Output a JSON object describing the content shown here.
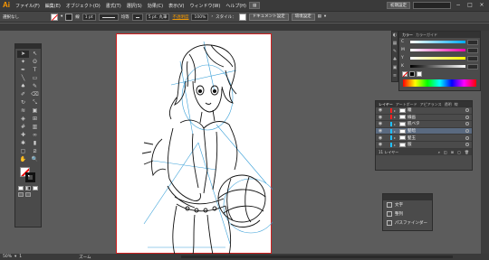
{
  "app": {
    "logo": "Ai"
  },
  "menu": [
    "ファイル(F)",
    "編集(E)",
    "オブジェクト(O)",
    "書式(T)",
    "選択(S)",
    "効果(C)",
    "表示(V)",
    "ウィンドウ(W)",
    "ヘルプ(H)"
  ],
  "workspace": {
    "label": "初期設定",
    "window_controls": [
      "−",
      "□",
      "×"
    ]
  },
  "control": {
    "selection_label": "選択なし",
    "stroke_weight": "1 pt",
    "stroke_profile_label": "均等",
    "brush_label": "5 pt. 丸筆",
    "opacity_link": "不透明度",
    "opacity_value": "100%",
    "style_label": "スタイル：",
    "doc_settings": "ドキュメント設定",
    "env_settings": "環境設定"
  },
  "tools": {
    "icons": [
      "selection-arrow",
      "direct-selection",
      "magic-wand",
      "lasso",
      "pen",
      "type",
      "line-segment",
      "rectangle",
      "paintbrush",
      "pencil",
      "blob-brush",
      "eraser",
      "rotate",
      "scale",
      "width",
      "free-transform",
      "shape-builder",
      "perspective-grid",
      "mesh",
      "gradient",
      "eyedropper",
      "blend",
      "symbol-sprayer",
      "column-graph",
      "artboard",
      "slice",
      "hand",
      "zoom"
    ],
    "glyphs": [
      "➤",
      "↖",
      "✦",
      "ʘ",
      "✒",
      "T",
      "╲",
      "▭",
      "♠",
      "✎",
      "✐",
      "⌫",
      "↻",
      "⤡",
      "≋",
      "▣",
      "◈",
      "⊞",
      "#",
      "▥",
      "✚",
      "∞",
      "✱",
      "▮",
      "▢",
      "⧄",
      "✋",
      "🔍"
    ]
  },
  "color_panel": {
    "tabs": [
      "カラー",
      "カラーガイド"
    ],
    "channels": [
      "C",
      "M",
      "Y",
      "K"
    ]
  },
  "layers_panel": {
    "tabs": [
      "レイヤー",
      "アートボード",
      "アピアランス",
      "透明",
      "線"
    ],
    "layers": [
      {
        "name": "瞳",
        "color": "#ff2020"
      },
      {
        "name": "線画",
        "color": "#ff2020"
      },
      {
        "name": "肌ベタ",
        "color": "#20c0ff"
      },
      {
        "name": "髪暗",
        "color": "#20c0ff"
      },
      {
        "name": "髪玉",
        "color": "#20c0ff"
      },
      {
        "name": "服",
        "color": "#20c0ff"
      }
    ],
    "footer": "11 レイヤー"
  },
  "pathfinder_panel": {
    "items": [
      "文字",
      "整列",
      "パスファインダー"
    ]
  },
  "status": {
    "zoom": "50%",
    "page": "1",
    "tool": "ズーム"
  }
}
